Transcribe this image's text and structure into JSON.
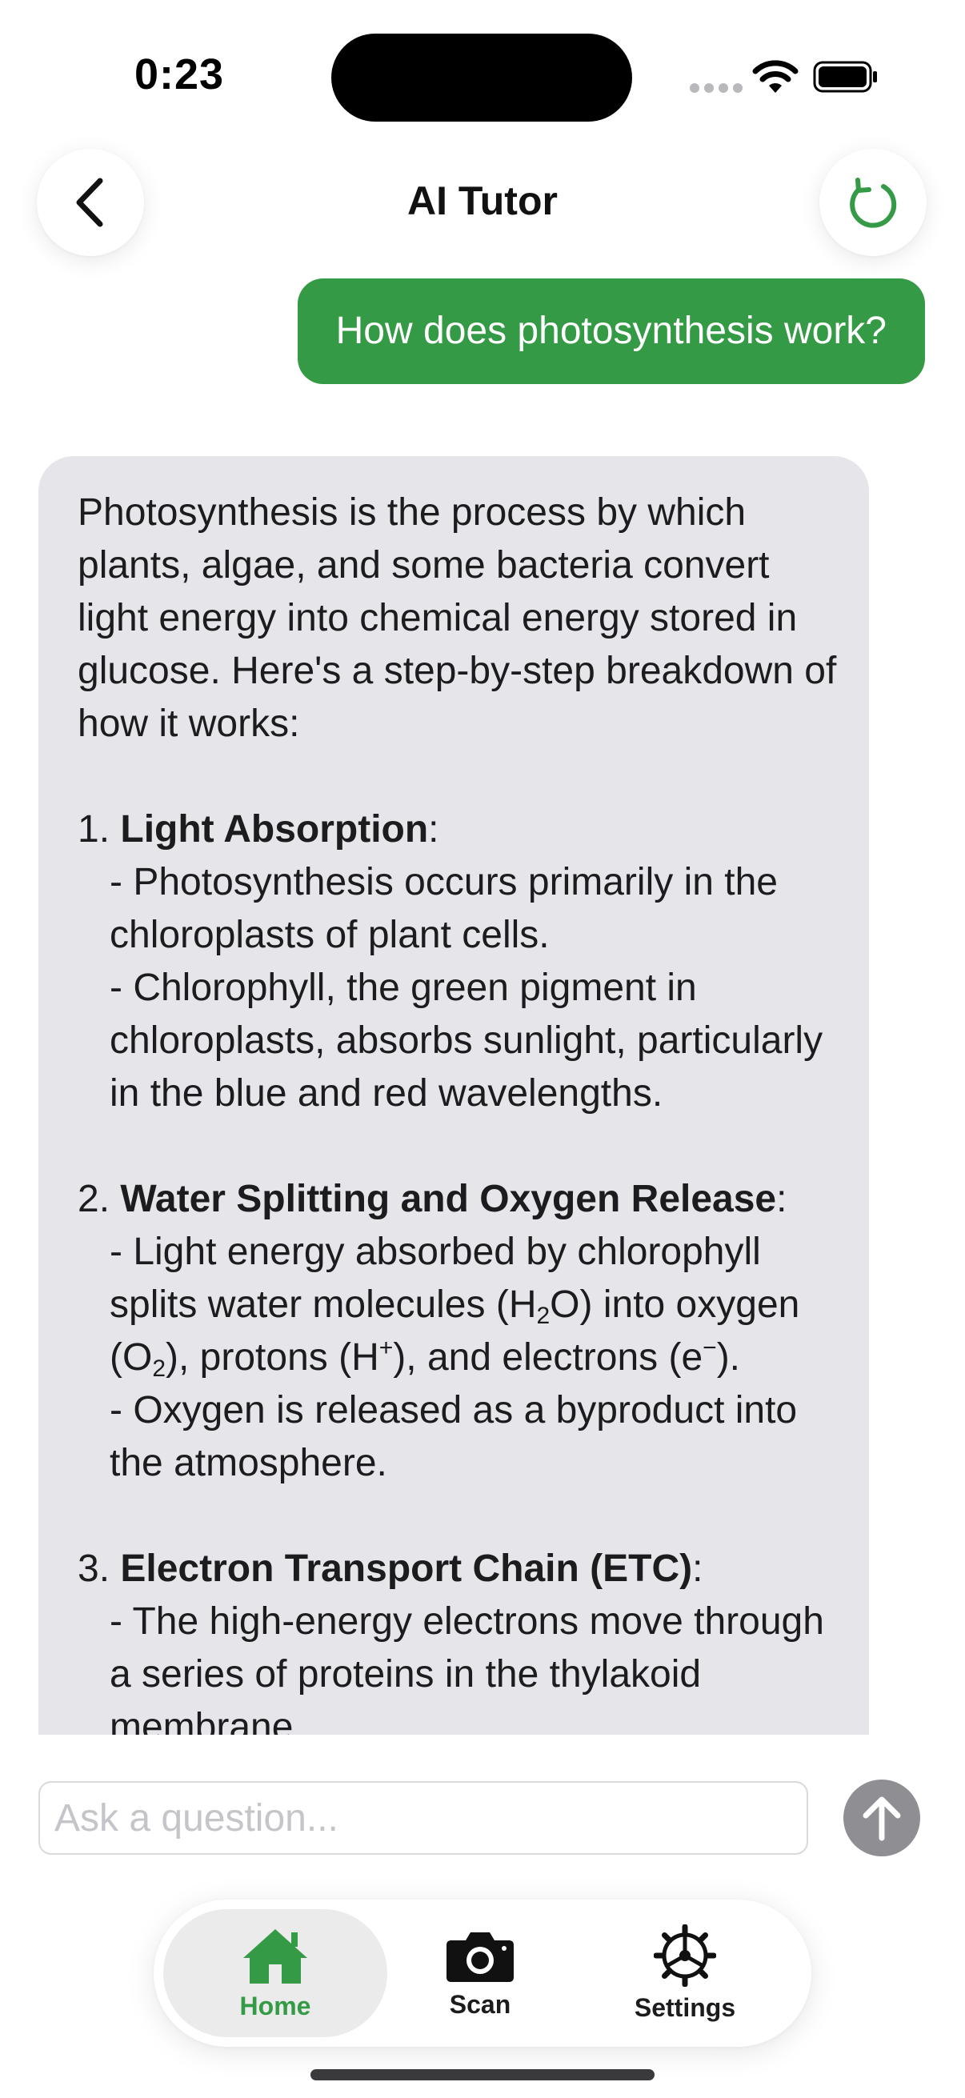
{
  "status": {
    "time": "0:23"
  },
  "nav": {
    "title": "AI Tutor"
  },
  "chat": {
    "user_message": "How does photosynthesis work?",
    "assistant": {
      "intro": "Photosynthesis is the process by which plants, algae, and some bacteria convert light energy into chemical energy stored in glucose. Here's a step-by-step breakdown of how it works:",
      "s1_num": "1. ",
      "s1_title": "Light Absorption",
      "s1_b1": "- Photosynthesis occurs primarily in the chloroplasts of plant cells.",
      "s1_b2": "- Chlorophyll, the green pigment in chloroplasts, absorbs sunlight, particularly in the blue and red wavelengths.",
      "s2_num": "2. ",
      "s2_title": "Water Splitting and Oxygen Release",
      "s2_b1_a": "- Light energy absorbed by chlorophyll splits water molecules (H",
      "s2_b1_sub1": "2",
      "s2_b1_b": "O) into oxygen (O",
      "s2_b1_sub2": "2",
      "s2_b1_c": "), protons (H",
      "s2_b1_sup1": "+",
      "s2_b1_d": "), and electrons (e",
      "s2_b1_sup2": "−",
      "s2_b1_e": ").",
      "s2_b2": "- Oxygen is released as a byproduct into the atmosphere.",
      "s3_num": "3. ",
      "s3_title": "Electron Transport Chain (ETC)",
      "s3_b1": "- The high-energy electrons move through a series of proteins in the thylakoid membrane."
    }
  },
  "composer": {
    "placeholder": "Ask a question..."
  },
  "tabs": [
    {
      "label": "Home",
      "icon": "house-icon",
      "active": true
    },
    {
      "label": "Scan",
      "icon": "camera-icon",
      "active": false
    },
    {
      "label": "Settings",
      "icon": "gear-icon",
      "active": false
    }
  ],
  "colors": {
    "accent_green": "#359a45",
    "assistant_bubble": "#e5e5ea",
    "send_button": "#8e8e93",
    "active_tab_bg": "#ebebeb"
  }
}
